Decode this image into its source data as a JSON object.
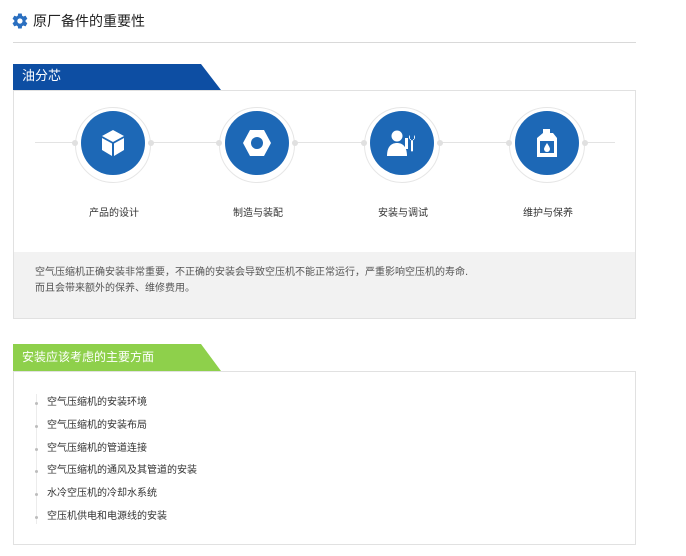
{
  "header": {
    "title": "原厂备件的重要性",
    "icon": "gear-icon"
  },
  "colors": {
    "primary_blue": "#0d4ea3",
    "circle_blue": "#1d68b6",
    "accent_green": "#8ed04b"
  },
  "section1": {
    "tab_label": "油分芯",
    "steps": [
      {
        "label": "产品的设计",
        "icon": "cube-icon"
      },
      {
        "label": "制造与装配",
        "icon": "hex-nut-icon"
      },
      {
        "label": "安装与调试",
        "icon": "technician-wrench-icon"
      },
      {
        "label": "维护与保养",
        "icon": "oil-bottle-icon"
      }
    ],
    "note_line1": "空气压缩机正确安装非常重要，不正确的安装会导致空压机不能正常运行，严重影响空压机的寿命.",
    "note_line2": "而且会带来额外的保养、维修费用。"
  },
  "section2": {
    "tab_label": "安装应该考虑的主要方面",
    "items": [
      "空气压缩机的安装环境",
      "空气压缩机的安装布局",
      "空气压缩机的管道连接",
      "空气压缩机的通风及其管道的安装",
      "水冷空压机的冷却水系统",
      "空压机供电和电源线的安装"
    ]
  }
}
